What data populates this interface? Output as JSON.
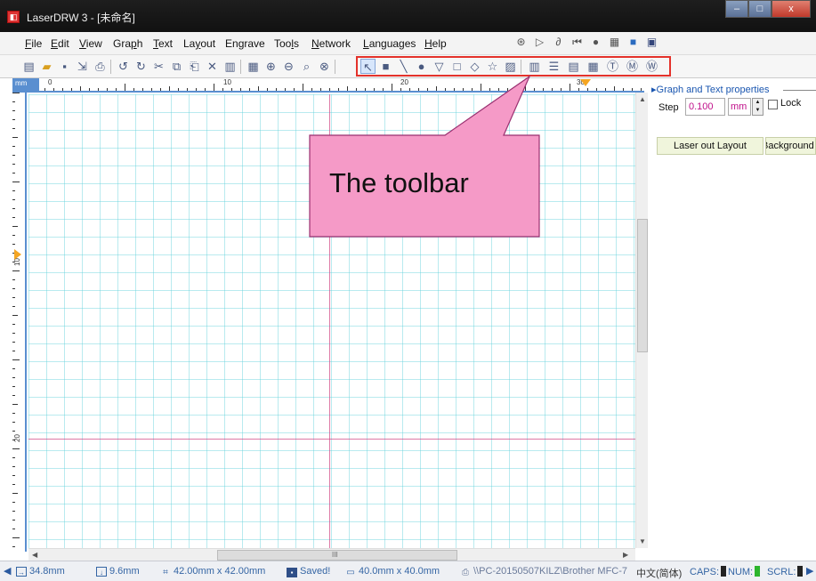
{
  "window": {
    "title": "LaserDRW 3 - [未命名]",
    "controls": [
      "–",
      "□",
      "x"
    ]
  },
  "menubar": {
    "items": [
      {
        "key": "F",
        "rest": "ile"
      },
      {
        "key": "E",
        "rest": "dit"
      },
      {
        "key": "V",
        "rest": "iew"
      },
      {
        "pre": "Gra",
        "key": "p",
        "rest": "h"
      },
      {
        "key": "T",
        "rest": "ext"
      },
      {
        "pre": "La",
        "key": "y",
        "rest": "out"
      },
      {
        "pre": "En",
        "key": "g",
        "rest": "rave"
      },
      {
        "pre": "Too",
        "key": "l",
        "rest": "s"
      },
      {
        "key": "N",
        "rest": "etwork"
      },
      {
        "key": "L",
        "rest": "anguages"
      },
      {
        "key": "H",
        "rest": "elp"
      }
    ]
  },
  "ruler": {
    "unit": "mm",
    "top_labels": [
      "0",
      "10",
      "20",
      "30"
    ],
    "left_labels": [
      "10",
      "20"
    ]
  },
  "properties_panel": {
    "header": "Graph and Text properties",
    "step_label": "Step",
    "step_value": "0.100",
    "unit": "mm",
    "lock_label": "Lock",
    "laser_out_button": "Laser out Layout",
    "background_button": "Background"
  },
  "callout": {
    "text": "The toolbar"
  },
  "scrollbar": {
    "grip": "III"
  },
  "statusbar": {
    "x_pos": "34.8mm",
    "y_pos": "9.6mm",
    "selection_size": "42.00mm x 42.00mm",
    "save_state": "Saved!",
    "page_size": "40.0mm x 40.0mm",
    "printer": "\\\\PC-20150507KILZ\\Brother MFC-7",
    "language": "中文(简体)",
    "caps": "CAPS:",
    "num": "NUM:",
    "scrl": "SCRL:"
  },
  "colors": {
    "highlight": "#e4322b",
    "callout_fill": "#f59ac7",
    "accent": "#3465a4"
  }
}
